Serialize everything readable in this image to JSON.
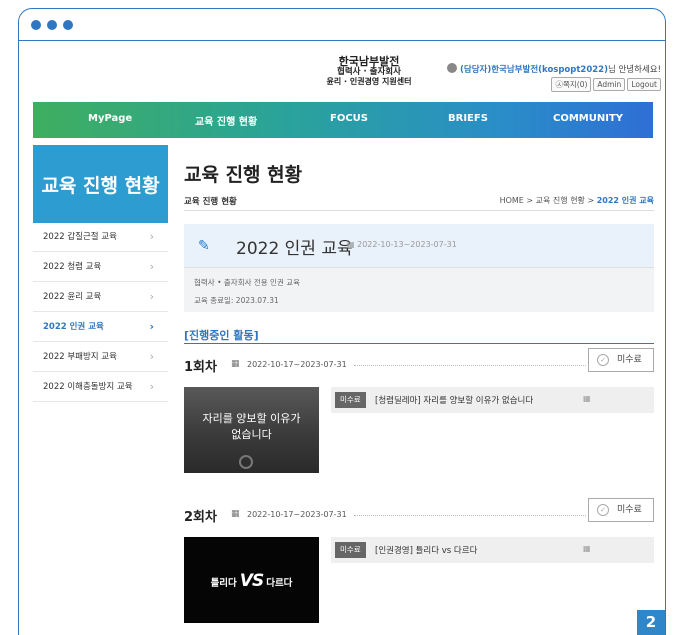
{
  "header": {
    "logo_line1": "한국남부발전",
    "logo_line2": "협력사 · 출자회사",
    "logo_line3": "윤리 · 인권경영 지원센터",
    "user_name": "(담당자)한국남부발전(kospopt2022)",
    "user_greeting": "님 안녕하세요!",
    "buttons": {
      "message": "㉦쪽지(0)",
      "admin": "Admin",
      "logout": "Logout"
    }
  },
  "nav": {
    "items": [
      "MyPage",
      "교육 진행 현황",
      "FOCUS",
      "BRIEFS",
      "COMMUNITY"
    ]
  },
  "sidebar": {
    "title": "교육 진행 현황",
    "items": [
      {
        "label": "2022 갑질근절 교육"
      },
      {
        "label": "2022 청렴 교육"
      },
      {
        "label": "2022 윤리 교육"
      },
      {
        "label": "2022 인권 교육",
        "active": true
      },
      {
        "label": "2022 부패방지 교육"
      },
      {
        "label": "2022 이해충돌방지 교육"
      }
    ]
  },
  "main": {
    "title": "교육 진행 현황",
    "subtitle": "교육 진행 현황",
    "breadcrumb": {
      "home": "HOME",
      "sep": ">",
      "parent": "교육 진행 현황",
      "current": "2022 인권 교육"
    },
    "course": {
      "title": "2022 인권 교육",
      "date": "2022-10-13~2023-07-31",
      "desc": "협력사 • 출자회사 전용 인권 교육",
      "end": "교육 종료일: 2023.07.31"
    },
    "section_title": "[진행중인 활동]",
    "sessions": [
      {
        "no": "1회차",
        "date": "2022-10-17~2023-07-31",
        "status": "미수료",
        "thumb_text_1": "자리를 양보할 이유가",
        "thumb_text_2": "없습니다",
        "badge": "미수료",
        "lesson": "[청렴딜레마] 자리를 양보할 이유가 없습니다"
      },
      {
        "no": "2회차",
        "date": "2022-10-17~2023-07-31",
        "status": "미수료",
        "thumb_left": "틀리다",
        "thumb_vs": "VS",
        "thumb_right": "다르다",
        "badge": "미수료",
        "lesson": "[인권경영] 틀리다 vs 다르다"
      }
    ]
  },
  "page_number": "2",
  "colors": {
    "accent": "#2f77c0",
    "sidebar_title_bg": "#2d9cd0",
    "nav_start": "#3fae5f",
    "nav_end": "#2f6ed6",
    "badge_bg": "#666666"
  },
  "icons": {
    "user": "user-icon",
    "edit": "pencil-icon",
    "calendar": "calendar-icon",
    "check": "check-circle-icon",
    "chevron": "chevron-right-icon"
  }
}
